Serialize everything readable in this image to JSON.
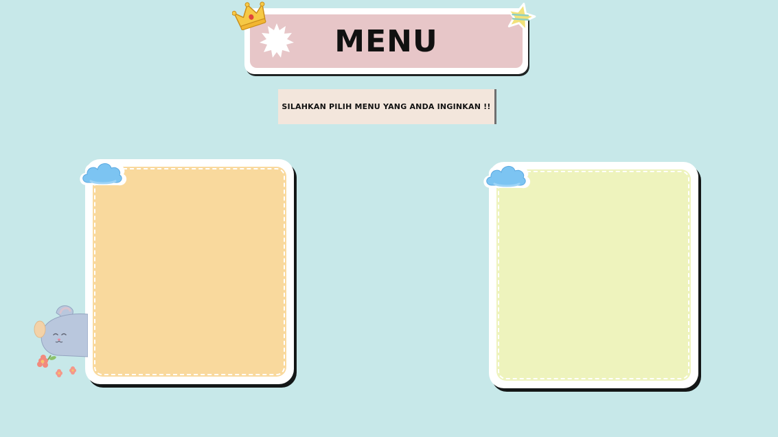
{
  "header": {
    "title": "MENU"
  },
  "instruction": {
    "text": "SILAHKAN PILIH MENU YANG ANDA INGINKAN !!"
  },
  "cards": [
    {
      "id": "left",
      "label": "",
      "fill_color": "#f9d99d"
    },
    {
      "id": "right",
      "label": "",
      "fill_color": "#eef3bd"
    }
  ],
  "icons": {
    "crown": "crown-icon",
    "star": "star-icon",
    "burst": "burst-icon",
    "cloud": "cloud-icon",
    "bunny": "bunny-illustration"
  },
  "colors": {
    "background": "#c7e8e9",
    "banner": "#e7c6c8",
    "subtitle_bg": "#f3e6dc"
  }
}
